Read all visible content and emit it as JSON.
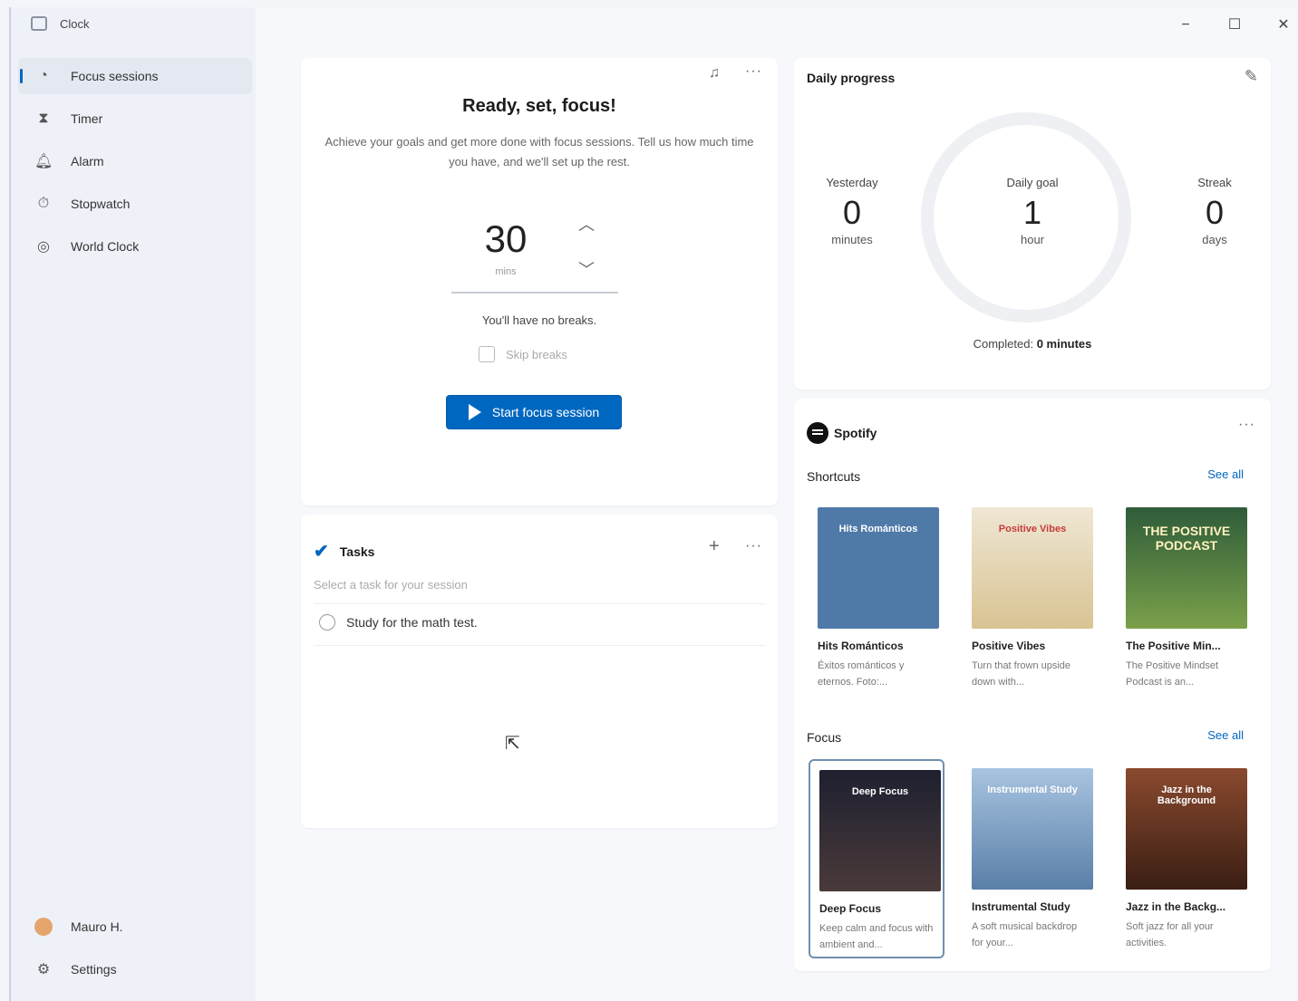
{
  "app": {
    "title": "Clock"
  },
  "window_controls": {
    "minimize": "−",
    "maximize": "☐",
    "close": "✕"
  },
  "sidebar": {
    "items": [
      {
        "label": "Focus sessions",
        "icon": "focus-icon",
        "active": true
      },
      {
        "label": "Timer",
        "icon": "hourglass-icon"
      },
      {
        "label": "Alarm",
        "icon": "bell-icon"
      },
      {
        "label": "Stopwatch",
        "icon": "stopwatch-icon"
      },
      {
        "label": "World Clock",
        "icon": "globe-icon"
      }
    ],
    "user": "Mauro H.",
    "settings": "Settings"
  },
  "focus": {
    "title": "Ready, set, focus!",
    "description": "Achieve your goals and get more done with focus sessions. Tell us how much time you have, and we'll set up the rest.",
    "minutes": "30",
    "unit": "mins",
    "breaks_text": "You'll have no breaks.",
    "skip_breaks": "Skip breaks",
    "start_button": "Start focus session"
  },
  "tasks": {
    "title": "Tasks",
    "subtitle": "Select a task for your session",
    "items": [
      "Study for the math test."
    ]
  },
  "daily_progress": {
    "title": "Daily progress",
    "yesterday": {
      "label": "Yesterday",
      "value": "0",
      "unit": "minutes"
    },
    "daily_goal": {
      "label": "Daily goal",
      "value": "1",
      "unit": "hour"
    },
    "streak": {
      "label": "Streak",
      "value": "0",
      "unit": "days"
    },
    "completed_label": "Completed:",
    "completed_value": "0 minutes"
  },
  "spotify": {
    "title": "Spotify",
    "shortcuts": {
      "title": "Shortcuts",
      "see_all": "See all",
      "items": [
        {
          "name": "Hits Románticos",
          "desc": "Éxitos románticos y eternos. Foto:...",
          "art_text": "Hits Románticos",
          "color": "#4f7aa8"
        },
        {
          "name": "Positive Vibes",
          "desc": "Turn that frown upside down with...",
          "art_text": "Positive Vibes",
          "color": "#e7d9b7"
        },
        {
          "name": "The Positive Min...",
          "desc": "The Positive Mindset Podcast is an...",
          "art_text": "THE POSITIVE PODCAST",
          "color": "#2f5c3a"
        }
      ]
    },
    "focus": {
      "title": "Focus",
      "see_all": "See all",
      "items": [
        {
          "name": "Deep Focus",
          "desc": "Keep calm and focus with ambient and...",
          "art_text": "Deep Focus",
          "color": "#2b2a33"
        },
        {
          "name": "Instrumental Study",
          "desc": "A soft musical backdrop for your...",
          "art_text": "Instrumental Study",
          "color": "#7ea3c9"
        },
        {
          "name": "Jazz in the Backg...",
          "desc": "Soft jazz for all your activities.",
          "art_text": "Jazz in the Background",
          "color": "#7a3b28"
        }
      ]
    }
  }
}
